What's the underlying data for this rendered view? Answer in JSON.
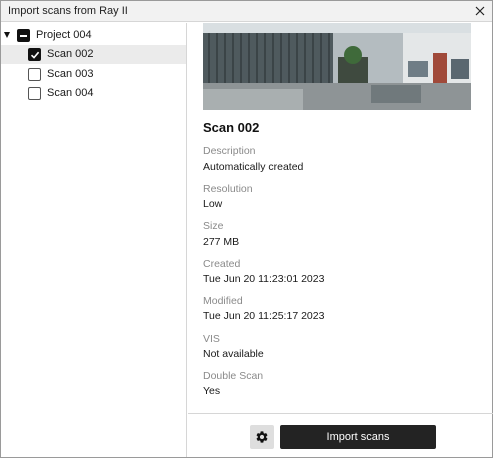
{
  "window": {
    "title": "Import scans from Ray II"
  },
  "tree": {
    "project": {
      "label": "Project 004",
      "state": "partial"
    },
    "scans": [
      {
        "label": "Scan 002",
        "checked": true,
        "selected": true
      },
      {
        "label": "Scan 003",
        "checked": false,
        "selected": false
      },
      {
        "label": "Scan 004",
        "checked": false,
        "selected": false
      }
    ]
  },
  "details": {
    "name": "Scan 002",
    "fields": [
      {
        "label": "Description",
        "value": "Automatically created"
      },
      {
        "label": "Resolution",
        "value": "Low"
      },
      {
        "label": "Size",
        "value": "277 MB"
      },
      {
        "label": "Created",
        "value": "Tue Jun 20 11:23:01 2023"
      },
      {
        "label": "Modified",
        "value": "Tue Jun 20 11:25:17 2023"
      },
      {
        "label": "VIS",
        "value": "Not available"
      },
      {
        "label": "Double Scan",
        "value": "Yes"
      }
    ]
  },
  "footer": {
    "import_label": "Import scans"
  },
  "icons": {
    "close": "close-icon",
    "settings": "gear-icon",
    "expand": "caret-down-icon"
  }
}
